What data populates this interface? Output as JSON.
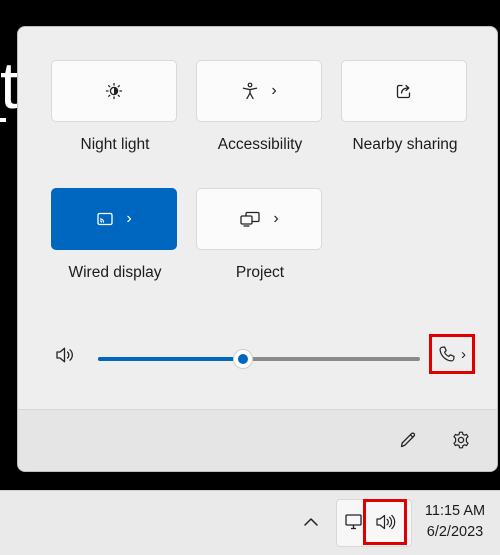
{
  "quick_settings": {
    "tiles": [
      {
        "label": "Night light",
        "icon": "night-light-icon",
        "active": false,
        "has_chevron": false
      },
      {
        "label": "Accessibility",
        "icon": "accessibility-icon",
        "active": false,
        "has_chevron": true
      },
      {
        "label": "Nearby sharing",
        "icon": "nearby-sharing-icon",
        "active": false,
        "has_chevron": false
      },
      {
        "label": "Wired display",
        "icon": "cast-icon",
        "active": true,
        "has_chevron": true
      },
      {
        "label": "Project",
        "icon": "project-icon",
        "active": false,
        "has_chevron": true
      }
    ],
    "volume": {
      "level_fraction": 0.45,
      "icon": "speaker-icon"
    },
    "audio_output": {
      "icon": "phone-icon",
      "chevron": "›"
    },
    "footer": {
      "edit_icon": "pencil-icon",
      "settings_icon": "gear-icon"
    }
  },
  "taskbar": {
    "overflow_icon": "chevron-up-icon",
    "network_icon": "network-icon",
    "volume_icon": "speaker-icon",
    "time": "11:15 AM",
    "date": "6/2/2023"
  },
  "background_fragment": "t",
  "colors": {
    "accent": "#0067c0",
    "highlight": "#e00000"
  }
}
